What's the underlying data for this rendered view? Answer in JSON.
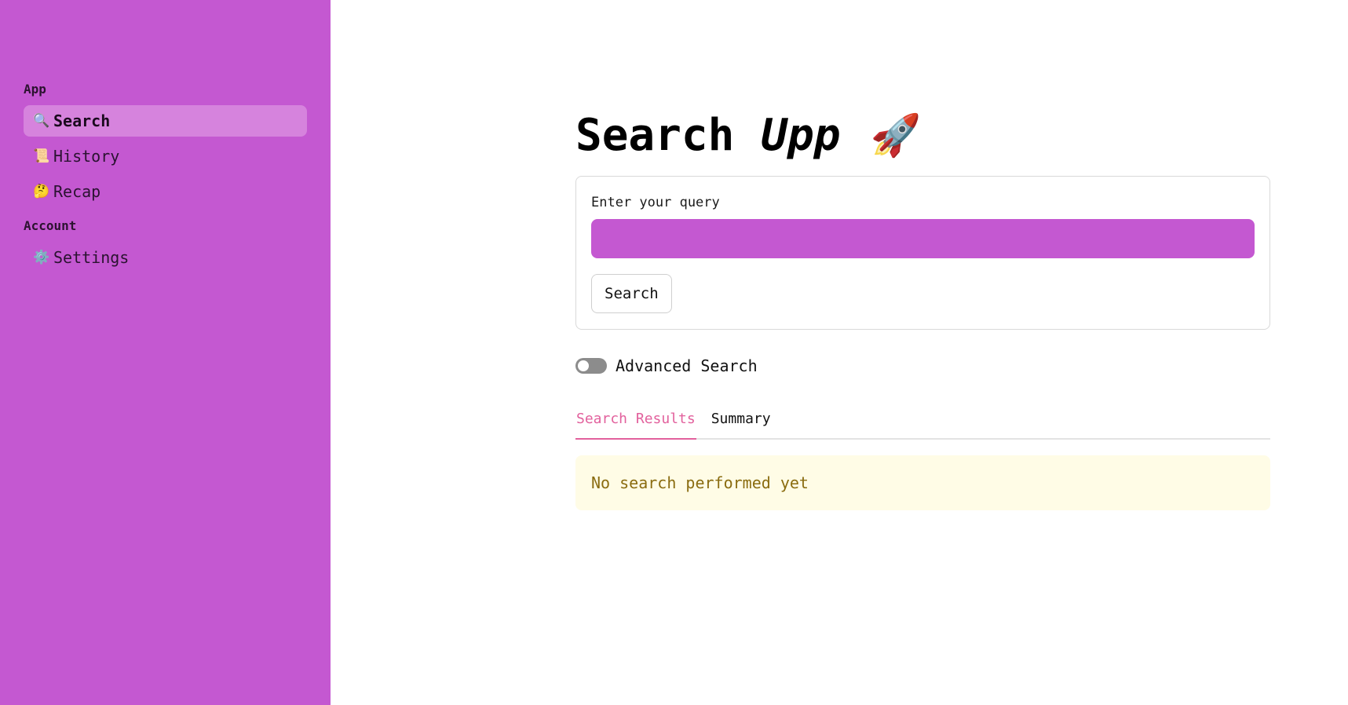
{
  "sidebar": {
    "sections": [
      {
        "label": "App",
        "items": [
          {
            "icon": "🔍",
            "icon_name": "magnifier-icon",
            "label": "Search",
            "active": true
          },
          {
            "icon": "📜",
            "icon_name": "scroll-icon",
            "label": "History",
            "active": false
          },
          {
            "icon": "🤔",
            "icon_name": "thinking-face-icon",
            "label": "Recap",
            "active": false
          }
        ]
      },
      {
        "label": "Account",
        "items": [
          {
            "icon": "⚙️",
            "icon_name": "gear-icon",
            "label": "Settings",
            "active": false
          }
        ]
      }
    ]
  },
  "main": {
    "title_word": "Search",
    "title_italic": "Upp",
    "title_emoji": "🚀",
    "query_label": "Enter your query",
    "query_value": "",
    "search_button": "Search",
    "advanced_toggle_label": "Advanced Search",
    "advanced_toggle_on": false,
    "tabs": [
      {
        "label": "Search Results",
        "active": true
      },
      {
        "label": "Summary",
        "active": false
      }
    ],
    "notice": "No search performed yet"
  },
  "colors": {
    "sidebar_bg": "#c458d1",
    "accent_tab": "#e2619d",
    "notice_bg": "#fffce6",
    "notice_text": "#8a6c10"
  }
}
